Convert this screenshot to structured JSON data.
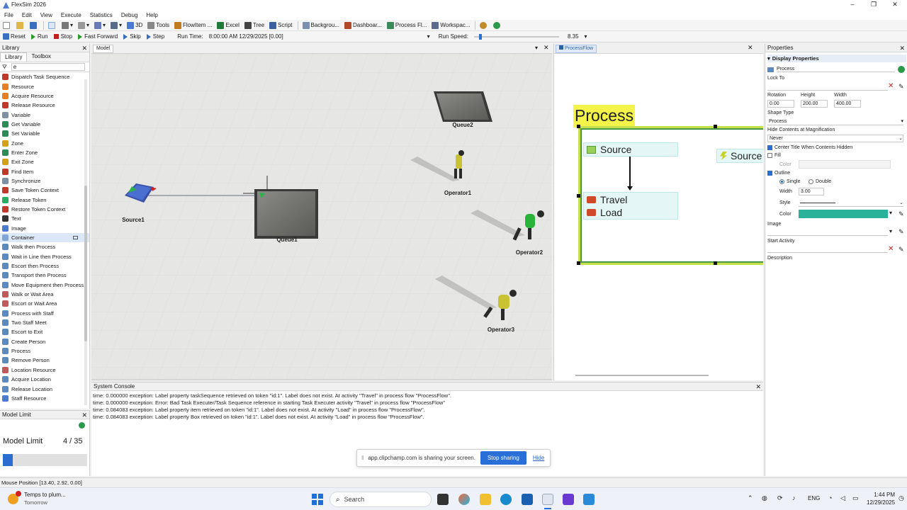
{
  "window": {
    "title": "FlexSim 2026"
  },
  "menu": [
    "File",
    "Edit",
    "View",
    "Execute",
    "Statistics",
    "Debug",
    "Help"
  ],
  "toolbar": {
    "buttons": [
      {
        "label": "3D",
        "icon": "cube-icon",
        "color": "#4a7bd0"
      },
      {
        "label": "Tools",
        "icon": "tools-icon",
        "color": "#888888"
      },
      {
        "label": "FlowItem ...",
        "icon": "flowitem-icon",
        "color": "#c07a20"
      },
      {
        "label": "Excel",
        "icon": "excel-icon",
        "color": "#1f7a3a"
      },
      {
        "label": "Tree",
        "icon": "tree-icon",
        "color": "#444444"
      },
      {
        "label": "Script",
        "icon": "script-icon",
        "color": "#3a5fa0"
      },
      {
        "label": "Backgrou...",
        "icon": "background-icon",
        "color": "#7a8fb0"
      },
      {
        "label": "Dashboar...",
        "icon": "dashboard-icon",
        "color": "#b04a2a"
      },
      {
        "label": "Process Fl...",
        "icon": "process-flow-icon",
        "color": "#3a8a5a"
      },
      {
        "label": "Workspac...",
        "icon": "workspace-icon",
        "color": "#5a6a8a"
      }
    ]
  },
  "runbar": {
    "reset": "Reset",
    "run": "Run",
    "stop": "Stop",
    "fast_forward": "Fast Forward",
    "skip": "Skip",
    "step": "Step",
    "run_time_label": "Run Time:",
    "run_time_value": "8:00:00 AM  12/29/2025  [0.00]",
    "run_speed_label": "Run Speed:",
    "run_speed_value": "8.35",
    "run_speed_fraction": 0.06
  },
  "library": {
    "title": "Library",
    "tabs": [
      "Library",
      "Toolbox"
    ],
    "filter": "e",
    "items": [
      {
        "label": "Dispatch Task Sequence",
        "color": "#c0392b"
      },
      {
        "label": "Resource",
        "color": "#e67e22"
      },
      {
        "label": "Acquire Resource",
        "color": "#e67e22"
      },
      {
        "label": "Release Resource",
        "color": "#c0392b"
      },
      {
        "label": "Variable",
        "color": "#7f8fa6"
      },
      {
        "label": "Get Variable",
        "color": "#2e8b57"
      },
      {
        "label": "Set Variable",
        "color": "#2e8b57"
      },
      {
        "label": "Zone",
        "color": "#d4a017"
      },
      {
        "label": "Enter Zone",
        "color": "#2e8b57"
      },
      {
        "label": "Exit Zone",
        "color": "#d4a017"
      },
      {
        "label": "Find Item",
        "color": "#c0392b"
      },
      {
        "label": "Synchronize",
        "color": "#7f8fa6"
      },
      {
        "label": "Save Token Context",
        "color": "#c0392b"
      },
      {
        "label": "Release Token",
        "color": "#27ae60"
      },
      {
        "label": "Restore Token Context",
        "color": "#c0392b"
      },
      {
        "label": "Text",
        "color": "#333333"
      },
      {
        "label": "Image",
        "color": "#4a7bd0"
      },
      {
        "label": "Container",
        "color": "#7fa6d8"
      },
      {
        "label": "Walk then Process",
        "color": "#5a8ac0"
      },
      {
        "label": "Wait in Line then Process",
        "color": "#5a8ac0"
      },
      {
        "label": "Escort then Process",
        "color": "#5a8ac0"
      },
      {
        "label": "Transport then Process",
        "color": "#5a8ac0"
      },
      {
        "label": "Move Equipment then Process",
        "color": "#5a8ac0"
      },
      {
        "label": "Walk or Wait Area",
        "color": "#c05a5a"
      },
      {
        "label": "Escort or Wait Area",
        "color": "#c05a5a"
      },
      {
        "label": "Process with Staff",
        "color": "#5a8ac0"
      },
      {
        "label": "Two Staff Meet",
        "color": "#5a8ac0"
      },
      {
        "label": "Escort to Exit",
        "color": "#5a8ac0"
      },
      {
        "label": "Create Person",
        "color": "#5a8ac0"
      },
      {
        "label": "Process",
        "color": "#5a8ac0"
      },
      {
        "label": "Remove Person",
        "color": "#5a8ac0"
      },
      {
        "label": "Location Resource",
        "color": "#c05a5a"
      },
      {
        "label": "Acquire Location",
        "color": "#5a8ac0"
      },
      {
        "label": "Release Location",
        "color": "#5a8ac0"
      },
      {
        "label": "Staff Resource",
        "color": "#4a7bd0"
      }
    ]
  },
  "model_limit": {
    "title": "Model Limit",
    "label": "Model Limit",
    "value": "4 / 35",
    "fraction": 0.114
  },
  "model": {
    "tab": "Model",
    "objects": {
      "source1": "Source1",
      "queue1": "Queue1",
      "queue2": "Queue2",
      "operator1": "Operator1",
      "operator2": "Operator2",
      "operator3": "Operator3"
    }
  },
  "processflow": {
    "tab": "ProcessFlow",
    "container_title": "Process",
    "blocks": {
      "source": "Source",
      "travel": "Travel",
      "load": "Load",
      "source_right": "Source"
    }
  },
  "properties": {
    "title": "Properties",
    "section": "Display Properties",
    "name": "Process",
    "lock_to": "Lock To",
    "rotation_label": "Rotation",
    "rotation": "0.00",
    "height_label": "Height",
    "height": "200.00",
    "width_label": "Width",
    "width": "400.00",
    "shape_type_label": "Shape Type",
    "shape_type": "Process",
    "hide_contents_label": "Hide Contents at Magnification",
    "hide_contents": "Never",
    "center_title_label": "Center Title When Contents Hidden",
    "fill_label": "Fill",
    "color_label": "Color",
    "outline_label": "Outline",
    "single_label": "Single",
    "double_label": "Double",
    "outline_width_label": "Width",
    "outline_width": "3.00",
    "style_label": "Style",
    "outline_color_label": "Color",
    "outline_color": "#2ab39a",
    "image_label": "Image",
    "start_activity_label": "Start Activity",
    "description_label": "Description"
  },
  "console": {
    "title": "System Console",
    "lines": [
      "time: 0.000000 exception: Label property taskSequence retrieved on token \"id:1\". Label does not exist. At activity \"Travel\" in process flow \"ProcessFlow\".",
      "time: 0.000000 exception: Error: Bad Task Executer/Task Sequence reference in starting Task Executer activity \"Travel\" in process flow \"ProcessFlow\"",
      "time: 0.084083 exception: Label property item retrieved on token \"id:1\". Label does not exist. At activity \"Load\" in process flow \"ProcessFlow\".",
      "time: 0.084083 exception: Label property Box retrieved on token \"id:1\". Label does not exist. At activity \"Load\" in process flow \"ProcessFlow\"."
    ]
  },
  "share": {
    "message": "app.clipchamp.com is sharing your screen.",
    "stop": "Stop sharing",
    "hide": "Hide"
  },
  "status": {
    "mouse_position": "Mouse Position [13.40, 2.92, 0.00]"
  },
  "taskbar": {
    "weather_title": "Temps to plum...",
    "weather_sub": "Tomorrow",
    "search": "Search",
    "language": "ENG",
    "time": "1:44 PM",
    "date": "12/29/2025"
  }
}
